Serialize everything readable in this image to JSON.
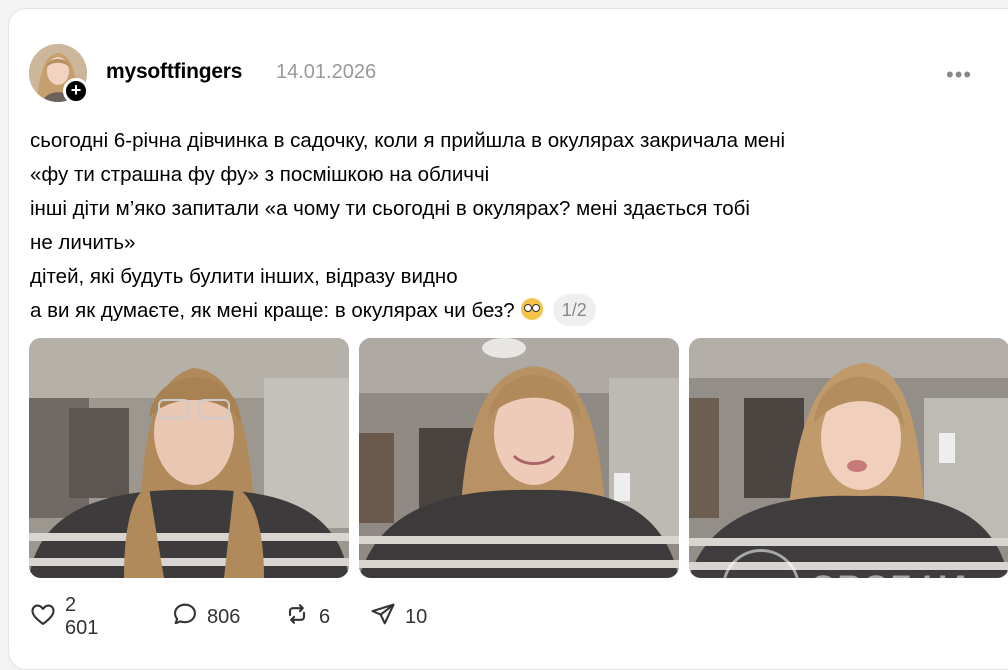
{
  "post": {
    "username": "mysoftfingers",
    "date": "14.01.2026",
    "follow_symbol": "+",
    "more_label": "•••",
    "lines": [
      "сьогодні 6-річна дівчинка в садочку, коли я прийшла в окулярах закричала мені",
      "«фу ти страшна фу фу» з посмішкою на обличчі",
      "інші діти м’яко запитали «а чому ти сьогодні в окулярах? мені здається тобі",
      "не личить»",
      "дітей, які будуть булити інших, відразу видно",
      "а ви як думаєте, як мені краще: в окулярах чи без?"
    ],
    "emoji_icon": "nerd-face-emoji",
    "image_counter": "1/2",
    "images": [
      {
        "name": "selfie-with-glasses"
      },
      {
        "name": "selfie-smiling"
      },
      {
        "name": "selfie-pouting"
      }
    ]
  },
  "actions": {
    "likes": "2 601",
    "comments": "806",
    "reposts": "6",
    "shares": "10"
  },
  "watermark": {
    "text": "OBOZ.UA"
  },
  "colors": {
    "date_gray": "#999999",
    "counter_bg": "#efefef",
    "icon_dark": "#333333"
  }
}
